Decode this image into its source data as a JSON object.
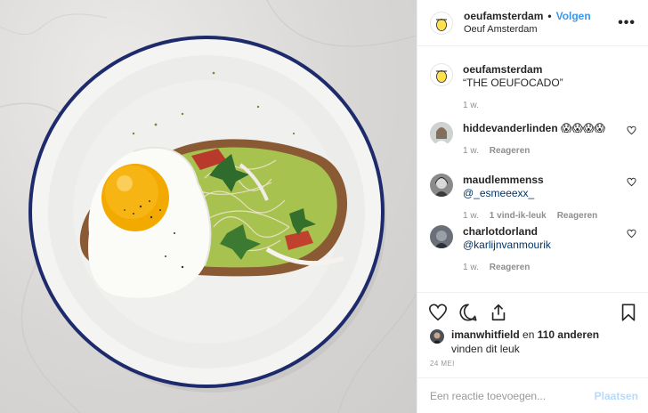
{
  "post": {
    "account": "oeufamsterdam",
    "follow_label": "Volgen",
    "separator": "•",
    "location": "Oeuf Amsterdam"
  },
  "caption": {
    "username": "oeufamsterdam",
    "text": "“THE OEUFOCADO”",
    "time": "1 w."
  },
  "comments": [
    {
      "username": "hiddevanderlinden",
      "text": "😱😱😱😱",
      "time": "1 w.",
      "likes": "",
      "reply": "Reageren"
    },
    {
      "username": "maudlemmenss",
      "text": "@_esmeeexx_",
      "time": "1 w.",
      "likes": "1 vind-ik-leuk",
      "reply": "Reageren"
    },
    {
      "username": "charlotdorland",
      "text": "@karlijnvanmourik",
      "time": "1 w.",
      "likes": "",
      "reply": "Reageren"
    }
  ],
  "likes": {
    "user": "imanwhitfield",
    "connector": "en",
    "others": "110 anderen",
    "suffix": "vinden dit leuk"
  },
  "date": "24 MEI",
  "add_comment": {
    "placeholder": "Een reactie toevoegen...",
    "post_label": "Plaatsen"
  },
  "icons": {
    "more": "more-icon",
    "like": "heart-icon",
    "comment": "comment-icon",
    "share": "share-icon",
    "save": "bookmark-icon"
  },
  "colors": {
    "link": "#3897f0",
    "muted": "#8e8e8e",
    "post_disabled": "#b3dbff",
    "plate_rim": "#1d2a6b"
  }
}
